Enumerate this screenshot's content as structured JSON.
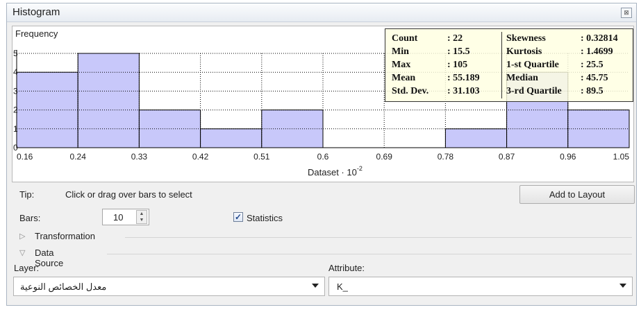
{
  "window": {
    "title": "Histogram",
    "close_glyph": "⊠"
  },
  "chart_data": {
    "type": "bar",
    "ylabel": "Frequency",
    "xlabel": "Dataset · 10",
    "xlabel_exponent": "-2",
    "x_ticks": [
      "0.16",
      "0.24",
      "0.33",
      "0.42",
      "0.51",
      "0.6",
      "0.69",
      "0.78",
      "0.87",
      "0.96",
      "1.05"
    ],
    "y_ticks": [
      "0",
      "1",
      "2",
      "3",
      "4",
      "5"
    ],
    "ylim": [
      0,
      5
    ],
    "values": [
      4,
      5,
      2,
      1,
      2,
      0,
      0,
      1,
      4,
      2
    ],
    "bar_color": "#c8c8fa",
    "grid": "dotted"
  },
  "statistics": {
    "left": [
      {
        "label": "Count",
        "value": ": 22"
      },
      {
        "label": "Min",
        "value": ": 15.5"
      },
      {
        "label": "Max",
        "value": ": 105"
      },
      {
        "label": "Mean",
        "value": ": 55.189"
      },
      {
        "label": "Std. Dev.",
        "value": ": 31.103"
      }
    ],
    "right": [
      {
        "label": "Skewness",
        "value": ": 0.32814"
      },
      {
        "label": "Kurtosis",
        "value": ": 1.4699"
      },
      {
        "label": "1-st Quartile",
        "value": ": 25.5"
      },
      {
        "label": "Median",
        "value": ": 45.75"
      },
      {
        "label": "3-rd Quartile",
        "value": ": 89.5"
      }
    ]
  },
  "controls": {
    "tip_label": "Tip:",
    "tip_text": "Click or drag over bars to select",
    "add_to_layout": "Add to Layout",
    "bars_label": "Bars:",
    "bars_value": "10",
    "statistics_label": "Statistics",
    "statistics_checked": true,
    "transformation_label": "Transformation",
    "data_source_label": "Data Source",
    "layer_label": "Layer:",
    "layer_value": "معدل الخصائص النوعية",
    "attribute_label": "Attribute:",
    "attribute_value": "K_"
  }
}
